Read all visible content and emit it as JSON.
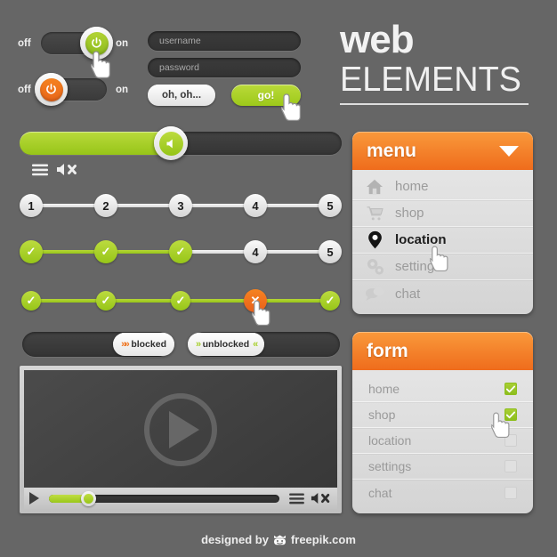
{
  "background_color": "#666666",
  "accent_green": "#a8cf33",
  "accent_orange": "#ef7622",
  "title": {
    "line1": "web",
    "line2": "ELEMENTS"
  },
  "toggles": [
    {
      "off_label": "off",
      "on_label": "on",
      "state": "on",
      "color": "#a8cf33",
      "icon": "power-icon"
    },
    {
      "off_label": "off",
      "on_label": "on",
      "state": "off",
      "color": "#ef7622",
      "icon": "power-icon"
    }
  ],
  "login": {
    "username_placeholder": "username",
    "password_placeholder": "password",
    "cancel_label": "oh, oh...",
    "submit_label": "go!"
  },
  "volume_slider": {
    "value": 47,
    "icon": "speaker-icon"
  },
  "media_icons": {
    "menu": "hamburger-icon",
    "mute": "speaker-mute-icon"
  },
  "steppers": [
    {
      "name": "numbered",
      "line_color": "#e8e8e8",
      "nodes": [
        {
          "label": "1",
          "state": "grey"
        },
        {
          "label": "2",
          "state": "grey"
        },
        {
          "label": "3",
          "state": "grey"
        },
        {
          "label": "4",
          "state": "grey"
        },
        {
          "label": "5",
          "state": "grey"
        }
      ]
    },
    {
      "name": "partial-complete",
      "nodes": [
        {
          "label": "✓",
          "state": "green"
        },
        {
          "label": "✓",
          "state": "green"
        },
        {
          "label": "✓",
          "state": "green"
        },
        {
          "label": "4",
          "state": "grey"
        },
        {
          "label": "5",
          "state": "grey"
        }
      ]
    },
    {
      "name": "error-step",
      "nodes": [
        {
          "label": "✓",
          "state": "green"
        },
        {
          "label": "✓",
          "state": "green"
        },
        {
          "label": "✓",
          "state": "green"
        },
        {
          "label": "✕",
          "state": "orange"
        },
        {
          "label": "✓",
          "state": "green"
        }
      ]
    }
  ],
  "blocked_toggle": {
    "label": "blocked",
    "chevrons": "»»",
    "position": "right"
  },
  "unblocked_toggle": {
    "label": "unblocked",
    "chevrons_left": "»",
    "chevrons_right": "«",
    "position": "left"
  },
  "video_player": {
    "play_overlay": "play-icon",
    "play_button": "play-icon",
    "progress": 17,
    "menu_icon": "hamburger-icon",
    "mute_icon": "speaker-mute-icon"
  },
  "menu_panel": {
    "title": "menu",
    "caret": "chevron-down-icon",
    "items": [
      {
        "label": "home",
        "icon": "home-icon",
        "active": false
      },
      {
        "label": "shop",
        "icon": "cart-icon",
        "active": false
      },
      {
        "label": "location",
        "icon": "pin-icon",
        "active": true
      },
      {
        "label": "settings",
        "icon": "gears-icon",
        "active": false
      },
      {
        "label": "chat",
        "icon": "chat-icon",
        "active": false
      }
    ]
  },
  "form_panel": {
    "title": "form",
    "items": [
      {
        "label": "home",
        "checked": true
      },
      {
        "label": "shop",
        "checked": true
      },
      {
        "label": "location",
        "checked": false
      },
      {
        "label": "settings",
        "checked": false
      },
      {
        "label": "chat",
        "checked": false
      }
    ]
  },
  "footer": {
    "prefix": "designed by",
    "brand": "freepik.com",
    "icon": "freepik-logo-icon"
  }
}
